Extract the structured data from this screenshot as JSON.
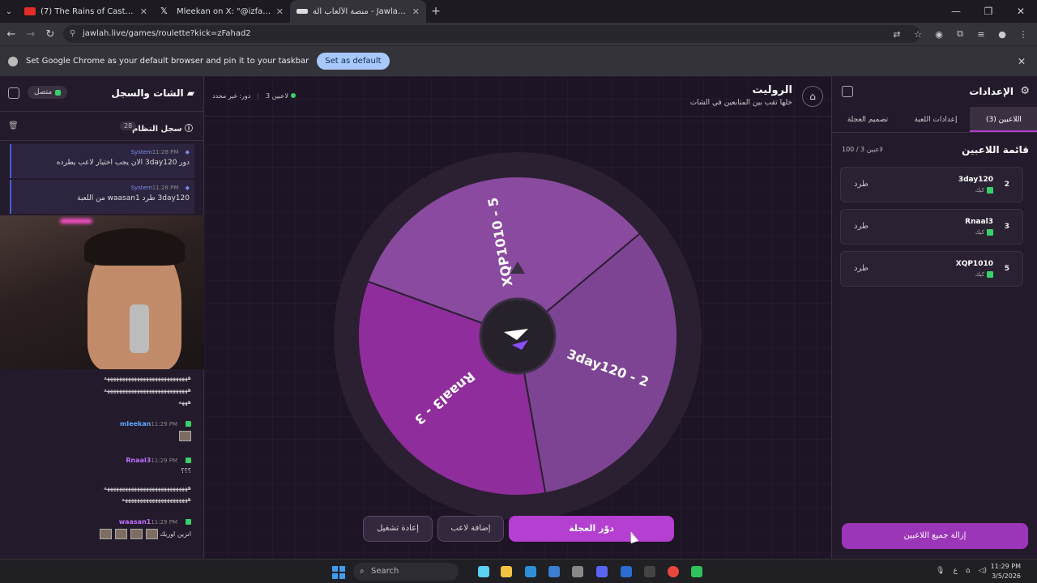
{
  "browser": {
    "tabs": [
      {
        "title": "(7) The Rains of Castamere [Re",
        "color": "#e52d27"
      },
      {
        "title": "Mleekan on X: \"@izfahad2 شعبك",
        "color": "#ffffff"
      },
      {
        "title": "منصة الألعاب الة - Jawlah | جولة",
        "color": "#ffffff"
      }
    ],
    "new_tab": "+",
    "url": "jawlah.live/games/roulette?kick=zFahad2",
    "infobar_message": "Set Google Chrome as your default browser and pin it to your taskbar",
    "set_default_label": "Set as default"
  },
  "left_panel": {
    "title": "الشات والسجل",
    "online_label": "متصل",
    "system_log": {
      "title": "سجل النظام",
      "count": "28"
    },
    "system_messages": [
      {
        "user": "System",
        "time": "11:28 PM",
        "text": "دور 3day120 الان يجب اختيار لاعب يطرده"
      },
      {
        "user": "System",
        "time": "11:28 PM",
        "text": "3day120 طرد waasan1 من اللعبة"
      }
    ],
    "chat": [
      {
        "text": "ههههههههههههههههههههههههههههه"
      },
      {
        "text": "ههههههههههههههههههههههههههههه"
      },
      {
        "text": "هههه"
      },
      {
        "user": "mleekan",
        "time": "11:29 PM",
        "color": "#5aa8ff"
      },
      {
        "user": "Rnaal3",
        "time": "11:29 PM",
        "color": "#c070ff",
        "text": "؟؟؟"
      },
      {
        "text": "ههههههههههههههههههههههههههههه"
      },
      {
        "text": "ههههههههههههههههههههههه"
      },
      {
        "user": "waasan1",
        "time": "11:29 PM",
        "color": "#c070ff",
        "text": "انزين اوريك"
      }
    ]
  },
  "center": {
    "title": "الروليت",
    "subtitle": "خلها تقب بين المتابعين في الشات",
    "players_count": "3 لاعبين",
    "turn": "دور: غير محدد",
    "wheel": {
      "segments": [
        {
          "label": "XQP1010 - 5",
          "fraction": 0.3333,
          "color": "#8a4a9f"
        },
        {
          "label": "3day120 - 2",
          "fraction": 0.3333,
          "color": "#7e4494"
        },
        {
          "label": "Rnaal3 - 3",
          "fraction": 0.3333,
          "color": "#8f2d9c"
        }
      ]
    },
    "buttons": {
      "spin": "دوّر العجلة",
      "add_player": "إضافة لاعب",
      "restart": "إعادة تشغيل"
    }
  },
  "right_panel": {
    "title": "الإعدادات",
    "tabs": [
      {
        "label": "اللاعبين (3)",
        "active": true
      },
      {
        "label": "إعدادات اللعبة",
        "active": false
      },
      {
        "label": "تصميم العجلة",
        "active": false
      }
    ],
    "list_title": "قائمة اللاعبين",
    "capacity": "100 / 3 لاعبين",
    "players": [
      {
        "number": "2",
        "name": "3day120",
        "platform": "كيك",
        "kick_label": "طرد"
      },
      {
        "number": "3",
        "name": "Rnaal3",
        "platform": "كيك",
        "kick_label": "طرد"
      },
      {
        "number": "5",
        "name": "XQP1010",
        "platform": "كيك",
        "kick_label": "طرد"
      }
    ],
    "remove_all": "إزالة جميع اللاعبين"
  },
  "taskbar": {
    "search_placeholder": "Search",
    "time": "11:29 PM",
    "date": "3/5/2026",
    "lang": "ع"
  }
}
